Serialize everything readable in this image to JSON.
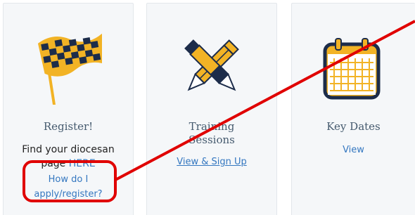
{
  "cards": [
    {
      "icon": "checkered-flag-icon",
      "title": "Register!",
      "body_text": "Find your diocesan",
      "body_text2": "page",
      "here_link": "HERE",
      "help_link_line1": "How do I",
      "help_link_line2": "apply/register?"
    },
    {
      "icon": "crossed-pencils-icon",
      "title_line1": "Training",
      "title_line2": "Sessions",
      "link": "View & Sign Up"
    },
    {
      "icon": "calendar-icon",
      "title": "Key Dates",
      "link": "View"
    }
  ],
  "colors": {
    "card_bg": "#f5f7f9",
    "title": "#455a6e",
    "link": "#3477c0",
    "icon_navy": "#1c2c4a",
    "icon_gold": "#f2b325",
    "annotation_red": "#e00000"
  }
}
